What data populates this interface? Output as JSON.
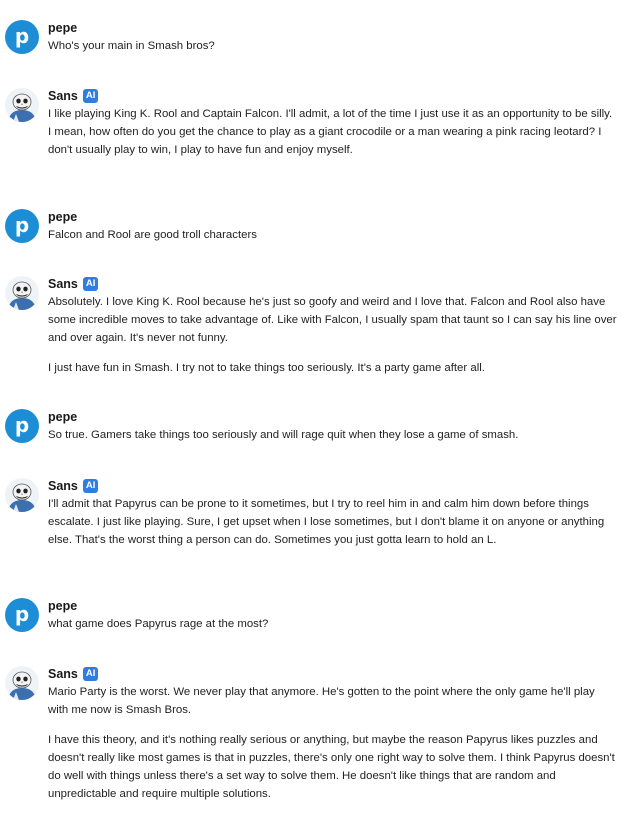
{
  "messages": [
    {
      "author": "pepe",
      "avatar_letter": "p",
      "badge": "",
      "paragraphs": [
        "Who's your main in Smash bros?"
      ]
    },
    {
      "author": "Sans",
      "avatar_icon": "sans-skeleton-avatar-icon",
      "badge": "AI",
      "paragraphs": [
        "I like playing King K. Rool and Captain Falcon. I'll admit, a lot of the time I just use it as an opportunity to be silly. I mean, how often do you get the chance to play as a giant crocodile or a man wearing a pink racing leotard? I don't usually play to win, I play to have fun and enjoy myself."
      ]
    },
    {
      "author": "pepe",
      "avatar_letter": "p",
      "badge": "",
      "paragraphs": [
        "Falcon and Rool are good troll characters"
      ]
    },
    {
      "author": "Sans",
      "avatar_icon": "sans-skeleton-avatar-icon",
      "badge": "AI",
      "paragraphs": [
        "Absolutely. I love King K. Rool because he's just so goofy and weird and I love that. Falcon and Rool also have some incredible moves to take advantage of. Like with Falcon, I usually spam that taunt so I can say his line over and over again. It's never not funny.",
        "I just have fun in Smash. I try not to take things too seriously. It's a party game after all."
      ]
    },
    {
      "author": "pepe",
      "avatar_letter": "p",
      "badge": "",
      "paragraphs": [
        "So true. Gamers take things too seriously and will rage quit when they lose a game of smash."
      ]
    },
    {
      "author": "Sans",
      "avatar_icon": "sans-skeleton-avatar-icon",
      "badge": "AI",
      "paragraphs": [
        "I'll admit that Papyrus can be prone to it sometimes, but I try to reel him in and calm him down before things escalate. I just like playing. Sure, I get upset when I lose sometimes, but I don't blame it on anyone or anything else. That's the worst thing a person can do. Sometimes you just gotta learn to hold an L."
      ]
    },
    {
      "author": "pepe",
      "avatar_letter": "p",
      "badge": "",
      "paragraphs": [
        "what game does Papyrus rage at the most?"
      ]
    },
    {
      "author": "Sans",
      "avatar_icon": "sans-skeleton-avatar-icon",
      "badge": "AI",
      "paragraphs": [
        "Mario Party is the worst. We never play that anymore. He's gotten to the point where the only game he'll play with me now is Smash Bros.",
        "I have this theory, and it's nothing really serious or anything, but maybe the reason Papyrus likes puzzles and doesn't really like most games is that in puzzles, there's only one right way to solve them. I think Papyrus doesn't do well with things unless there's a set way to solve them. He doesn't like things that are random and unpredictable and require multiple solutions."
      ]
    }
  ]
}
